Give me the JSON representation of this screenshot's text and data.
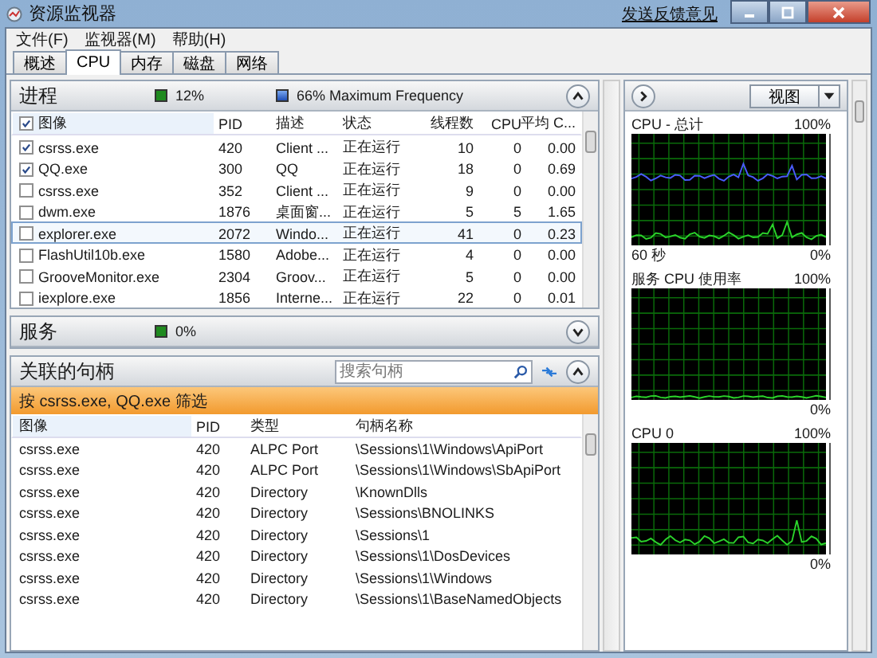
{
  "window": {
    "title": "资源监视器",
    "feedback_link": "发送反馈意见"
  },
  "menu": [
    "文件(F)",
    "监视器(M)",
    "帮助(H)"
  ],
  "tabs": [
    {
      "label": "概述",
      "selected": false
    },
    {
      "label": "CPU",
      "selected": true
    },
    {
      "label": "内存",
      "selected": false
    },
    {
      "label": "磁盘",
      "selected": false
    },
    {
      "label": "网络",
      "selected": false
    }
  ],
  "processes": {
    "title": "进程",
    "cpu_usage": "12%",
    "frequency": "66% Maximum Frequency",
    "expanded": true,
    "header_checked": true,
    "columns": [
      "图像",
      "PID",
      "描述",
      "状态",
      "线程数",
      "CPU",
      "平均 C..."
    ],
    "rows": [
      {
        "checked": true,
        "selected": false,
        "image": "csrss.exe",
        "pid": "420",
        "description": "Client ...",
        "status": "正在运行",
        "threads": "10",
        "cpu": "0",
        "avg_cpu": "0.00"
      },
      {
        "checked": true,
        "selected": false,
        "image": "QQ.exe",
        "pid": "300",
        "description": "QQ",
        "status": "正在运行",
        "threads": "18",
        "cpu": "0",
        "avg_cpu": "0.69"
      },
      {
        "checked": false,
        "selected": false,
        "image": "csrss.exe",
        "pid": "352",
        "description": "Client ...",
        "status": "正在运行",
        "threads": "9",
        "cpu": "0",
        "avg_cpu": "0.00"
      },
      {
        "checked": false,
        "selected": false,
        "image": "dwm.exe",
        "pid": "1876",
        "description": "桌面窗...",
        "status": "正在运行",
        "threads": "5",
        "cpu": "5",
        "avg_cpu": "1.65"
      },
      {
        "checked": false,
        "selected": true,
        "image": "explorer.exe",
        "pid": "2072",
        "description": "Windo...",
        "status": "正在运行",
        "threads": "41",
        "cpu": "0",
        "avg_cpu": "0.23"
      },
      {
        "checked": false,
        "selected": false,
        "image": "FlashUtil10b.exe",
        "pid": "1580",
        "description": "Adobe...",
        "status": "正在运行",
        "threads": "4",
        "cpu": "0",
        "avg_cpu": "0.00"
      },
      {
        "checked": false,
        "selected": false,
        "image": "GrooveMonitor.exe",
        "pid": "2304",
        "description": "Groov...",
        "status": "正在运行",
        "threads": "5",
        "cpu": "0",
        "avg_cpu": "0.00"
      },
      {
        "checked": false,
        "selected": false,
        "image": "iexplore.exe",
        "pid": "1856",
        "description": "Interne...",
        "status": "正在运行",
        "threads": "22",
        "cpu": "0",
        "avg_cpu": "0.01"
      }
    ]
  },
  "services": {
    "title": "服务",
    "cpu_usage": "0%",
    "expanded": false
  },
  "handles": {
    "title": "关联的句柄",
    "expanded": true,
    "search_placeholder": "搜索句柄",
    "filter": "按 csrss.exe, QQ.exe 筛选",
    "columns": [
      "图像",
      "PID",
      "类型",
      "句柄名称"
    ],
    "rows": [
      {
        "image": "csrss.exe",
        "pid": "420",
        "type": "ALPC Port",
        "name": "\\Sessions\\1\\Windows\\ApiPort"
      },
      {
        "image": "csrss.exe",
        "pid": "420",
        "type": "ALPC Port",
        "name": "\\Sessions\\1\\Windows\\SbApiPort"
      },
      {
        "image": "csrss.exe",
        "pid": "420",
        "type": "Directory",
        "name": "\\KnownDlls"
      },
      {
        "image": "csrss.exe",
        "pid": "420",
        "type": "Directory",
        "name": "\\Sessions\\BNOLINKS"
      },
      {
        "image": "csrss.exe",
        "pid": "420",
        "type": "Directory",
        "name": "\\Sessions\\1"
      },
      {
        "image": "csrss.exe",
        "pid": "420",
        "type": "Directory",
        "name": "\\Sessions\\1\\DosDevices"
      },
      {
        "image": "csrss.exe",
        "pid": "420",
        "type": "Directory",
        "name": "\\Sessions\\1\\Windows"
      },
      {
        "image": "csrss.exe",
        "pid": "420",
        "type": "Directory",
        "name": "\\Sessions\\1\\BaseNamedObjects"
      }
    ]
  },
  "graphs": {
    "view_button": "视图",
    "charts": [
      {
        "title": "CPU - 总计",
        "max": "100%",
        "time": "60 秒",
        "min": "0%"
      },
      {
        "title": "服务 CPU 使用率",
        "max": "100%",
        "min": "0%"
      },
      {
        "title": "CPU 0",
        "max": "100%",
        "min": "0%"
      }
    ]
  }
}
